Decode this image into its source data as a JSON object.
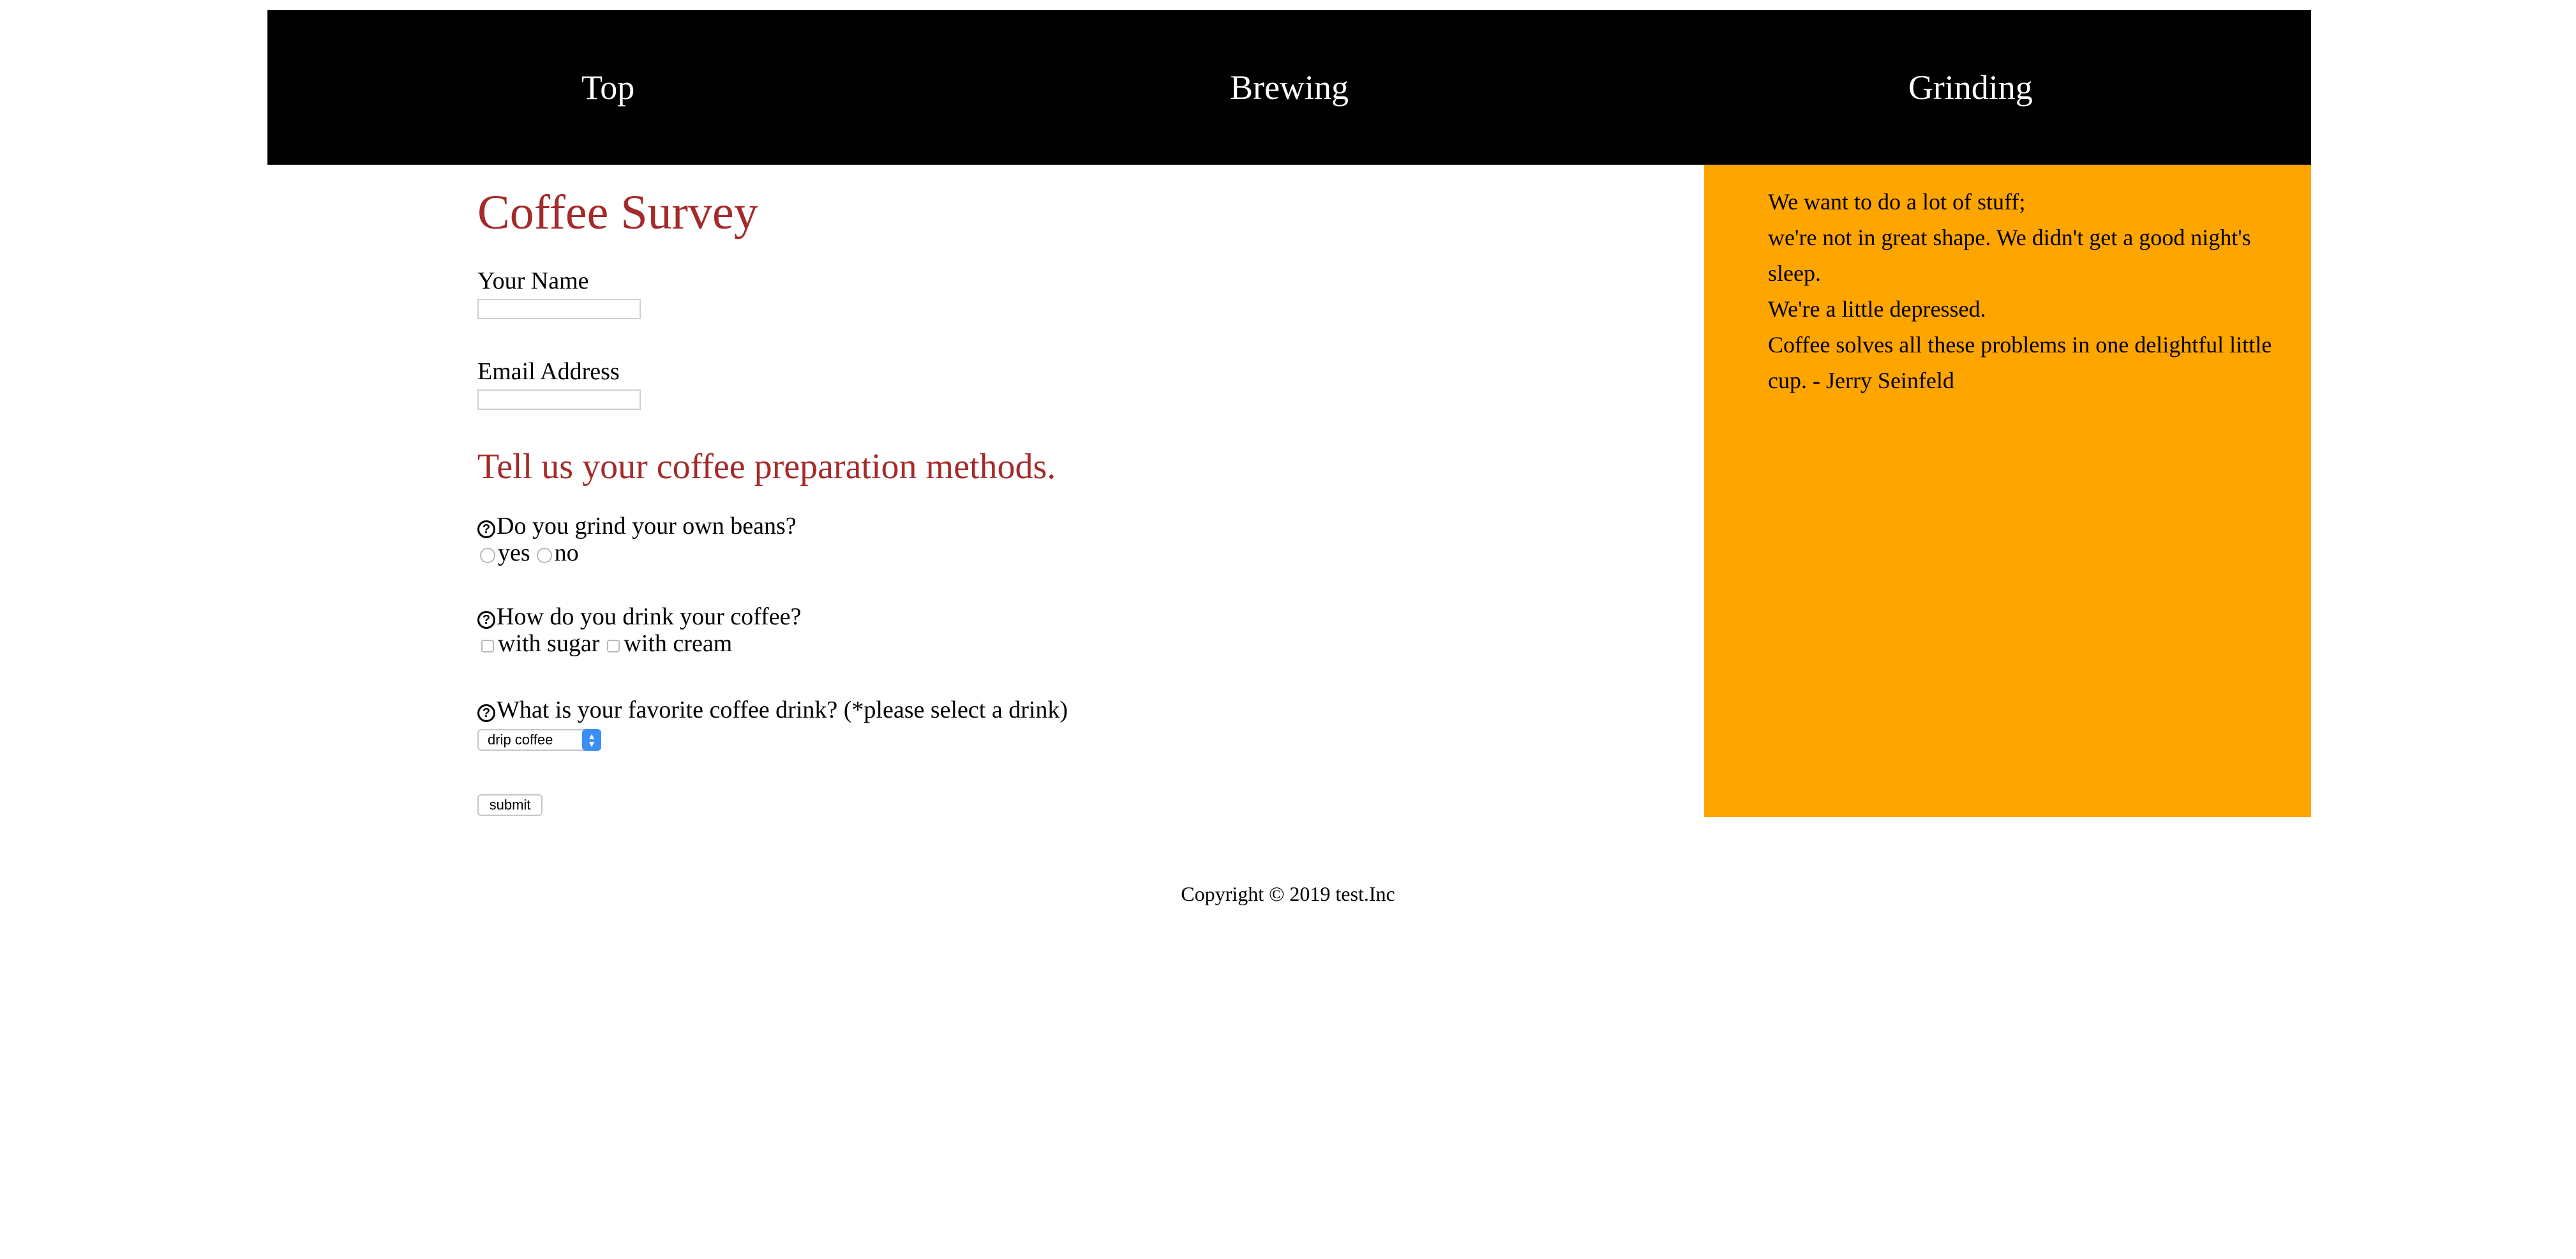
{
  "nav": {
    "items": [
      {
        "label": "Top"
      },
      {
        "label": "Brewing"
      },
      {
        "label": "Grinding"
      }
    ]
  },
  "form": {
    "title": "Coffee Survey",
    "name_label": "Your Name",
    "name_value": "",
    "email_label": "Email Address",
    "email_value": "",
    "section_heading": "Tell us your coffee preparation methods.",
    "q1": {
      "icon": "question-circle-icon",
      "text": "Do you grind your own beans?",
      "options": [
        "yes",
        "no"
      ]
    },
    "q2": {
      "icon": "question-circle-icon",
      "text": "How do you drink your coffee?",
      "options": [
        "with sugar",
        "with cream"
      ]
    },
    "q3": {
      "icon": "question-circle-icon",
      "text": "What is your favorite coffee drink?",
      "note": "(*please select a drink)",
      "selected": "drip coffee"
    },
    "submit_label": "submit"
  },
  "aside": {
    "background": "#ffa500",
    "lines": [
      "We want to do a lot of stuff;",
      "we're not in great shape. We didn't get a good night's sleep.",
      "We're a little depressed.",
      "Coffee solves all these problems in one delightful little cup. - Jerry Seinfeld"
    ]
  },
  "colors": {
    "heading": "#a52a2a",
    "nav_bg": "#000000",
    "aside_bg": "#ffa500",
    "select_accent": "#3b8ef5"
  },
  "footer": {
    "text": "Copyright © 2019 test.Inc"
  }
}
